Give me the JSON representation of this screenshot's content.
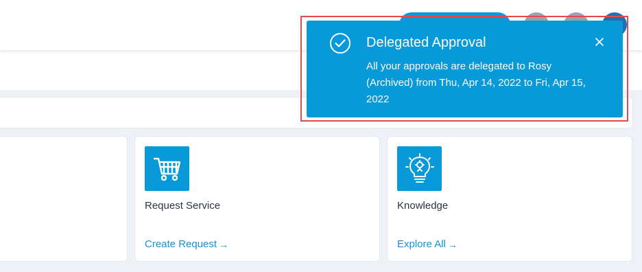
{
  "toast": {
    "title": "Delegated Approval",
    "message": "All your approvals are delegated to Rosy (Archived) from Thu, Apr 14, 2022 to Fri, Apr 15, 2022",
    "icon": "check-circle-icon",
    "close_icon": "close-icon",
    "background": "#0799d8"
  },
  "cards": [
    {
      "title": "Request Service",
      "link": "Create Request",
      "icon": "cart-icon"
    },
    {
      "title": "Knowledge",
      "link": "Explore All",
      "icon": "lightbulb-icon"
    }
  ],
  "colors": {
    "accent": "#0799d8",
    "link": "#1a8fd1",
    "highlight_outline": "#e5484d"
  }
}
